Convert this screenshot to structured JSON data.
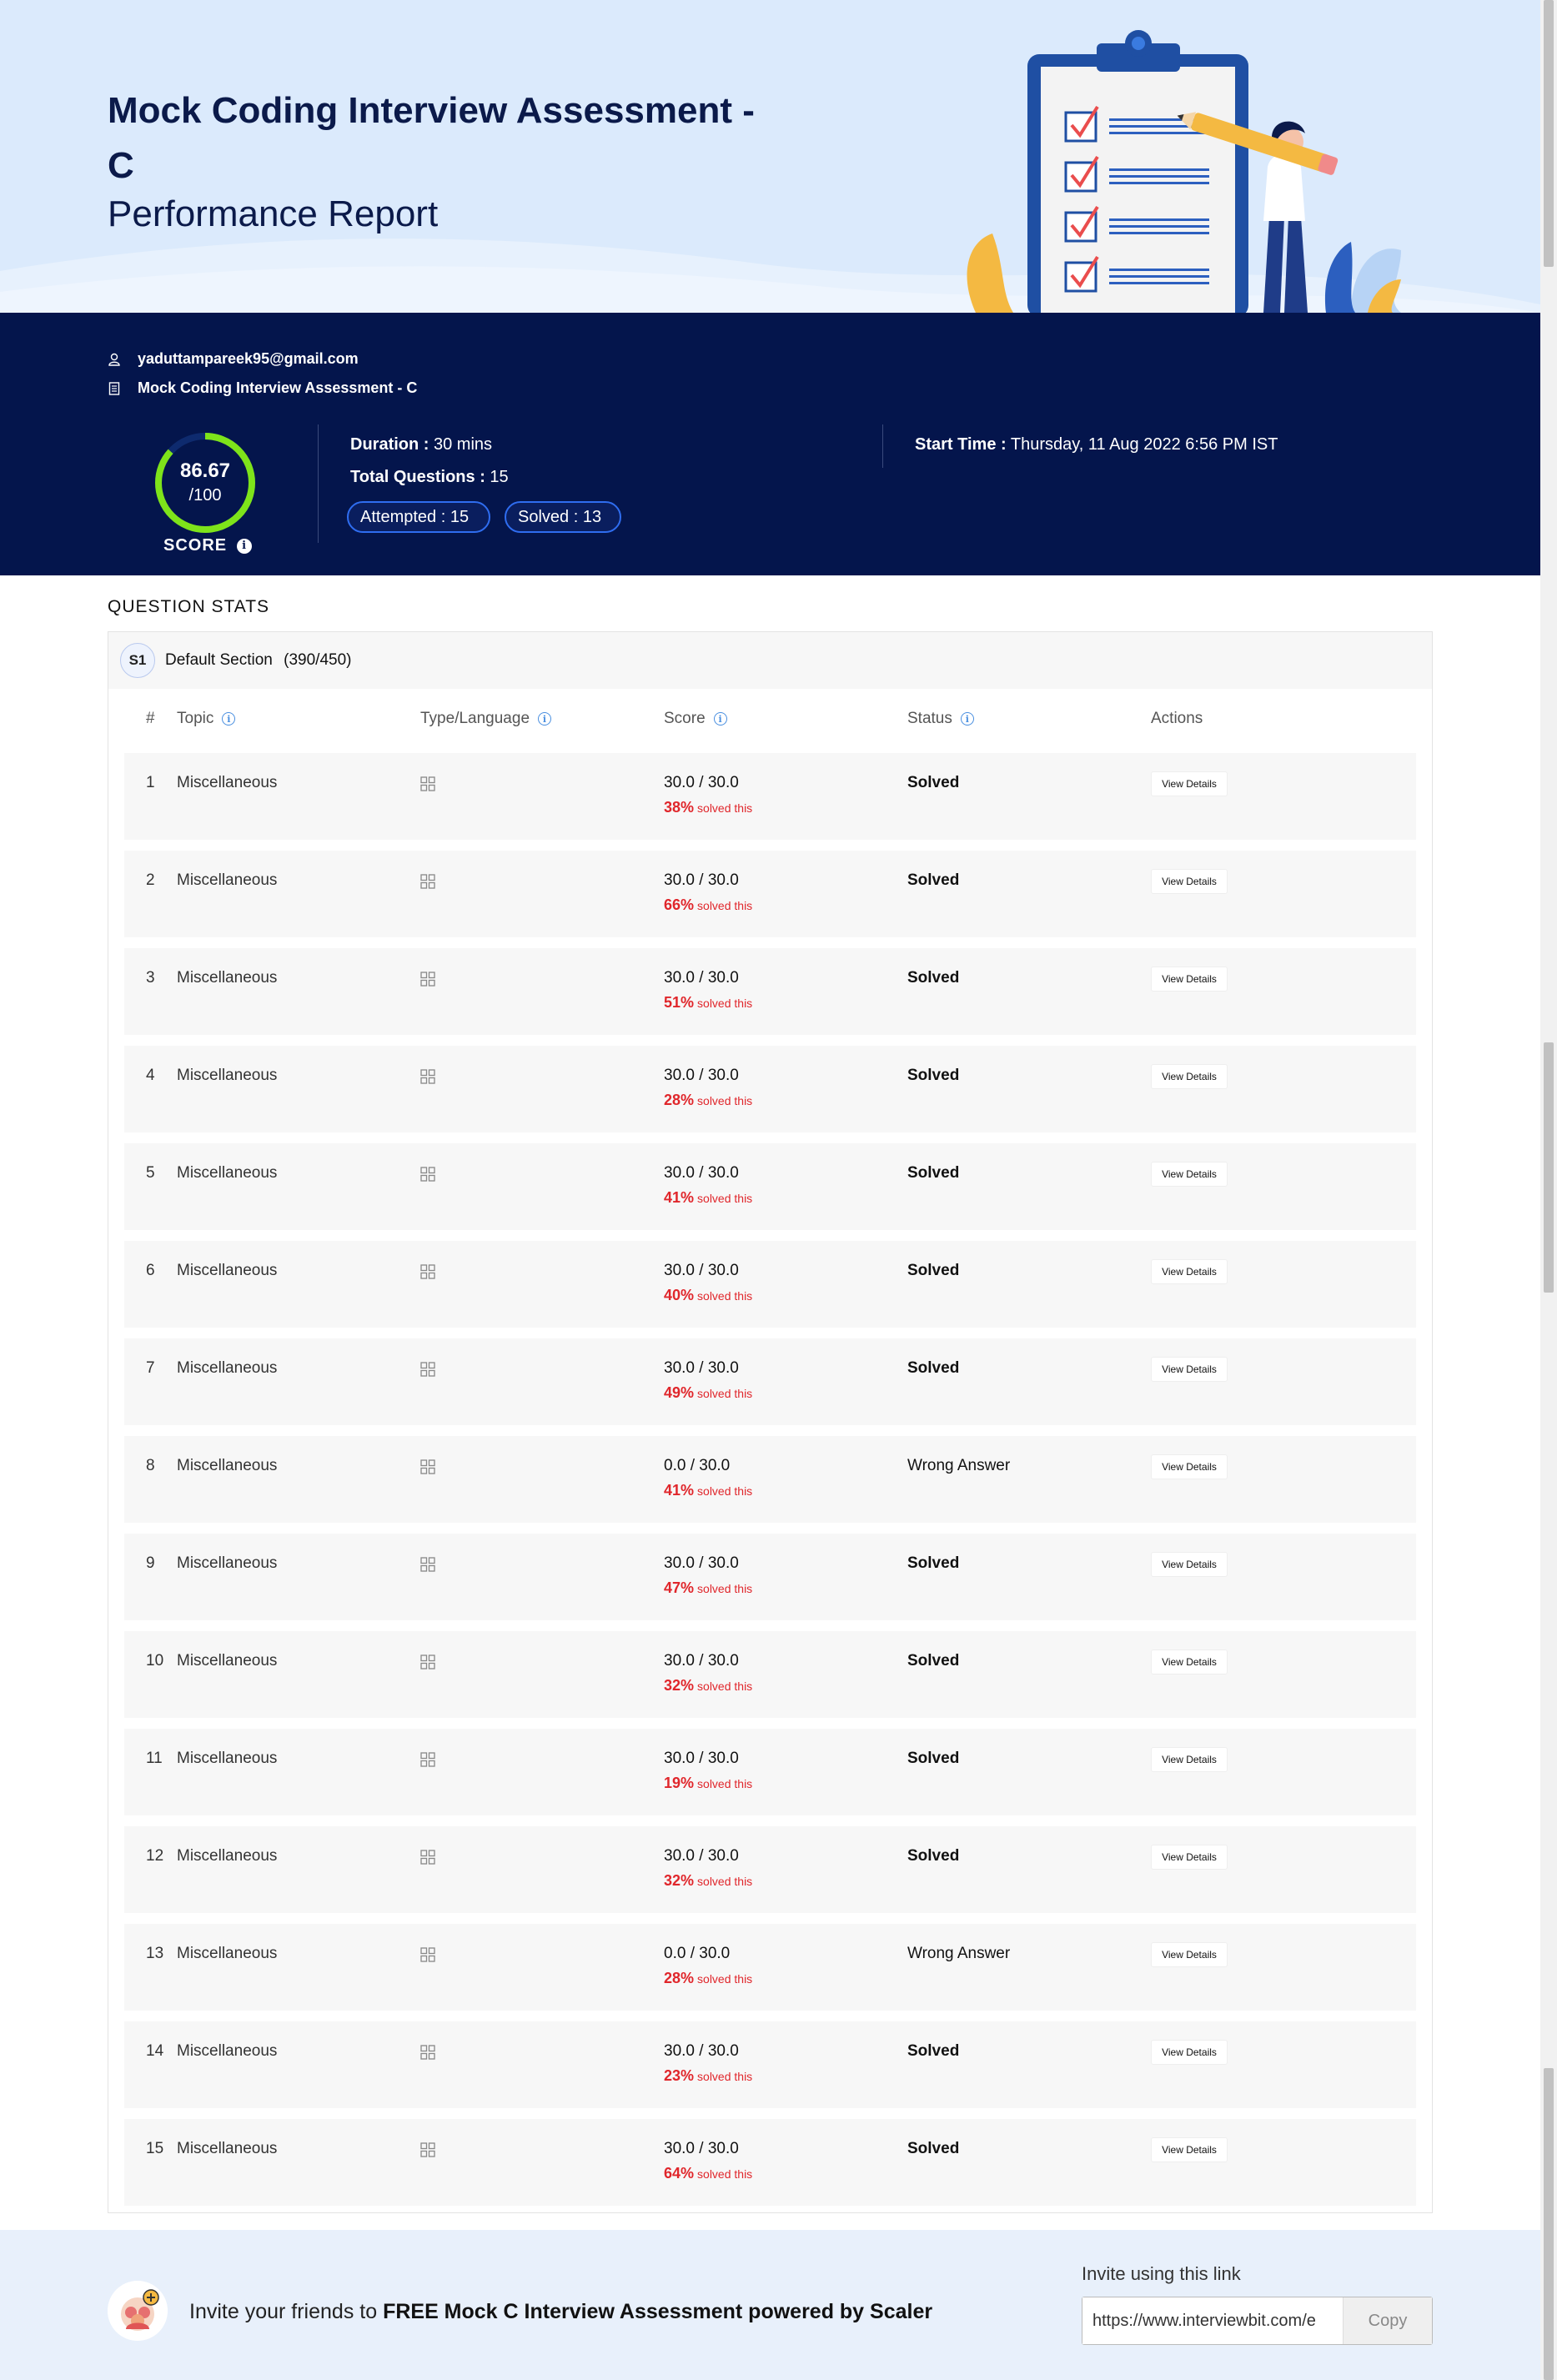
{
  "hero": {
    "title": "Mock Coding Interview Assessment - C",
    "subtitle": "Performance Report"
  },
  "summary": {
    "email": "yaduttampareek95@gmail.com",
    "assessment_name": "Mock Coding Interview Assessment - C",
    "score_value": "86.67",
    "score_total": "/100",
    "score_fraction": 0.8667,
    "score_label": "SCORE",
    "duration_label": "Duration :",
    "duration_value": "30 mins",
    "total_questions_label": "Total Questions :",
    "total_questions_value": "15",
    "attempted_pill": "Attempted : 15",
    "solved_pill": "Solved : 13",
    "start_time_label": "Start Time :",
    "start_time_value": "Thursday, 11 Aug 2022 6:56 PM IST"
  },
  "question_stats": {
    "heading": "QUESTION STATS",
    "section_badge": "S1",
    "section_name": "Default Section",
    "section_score": "(390/450)",
    "columns": {
      "num": "#",
      "topic": "Topic",
      "type": "Type/Language",
      "score": "Score",
      "status": "Status",
      "actions": "Actions"
    },
    "solved_suffix": "solved this",
    "action_label": "View Details",
    "rows": [
      {
        "num": "1",
        "topic": "Miscellaneous",
        "score": "30.0 / 30.0",
        "pct": "38%",
        "status": "Solved"
      },
      {
        "num": "2",
        "topic": "Miscellaneous",
        "score": "30.0 / 30.0",
        "pct": "66%",
        "status": "Solved"
      },
      {
        "num": "3",
        "topic": "Miscellaneous",
        "score": "30.0 / 30.0",
        "pct": "51%",
        "status": "Solved"
      },
      {
        "num": "4",
        "topic": "Miscellaneous",
        "score": "30.0 / 30.0",
        "pct": "28%",
        "status": "Solved"
      },
      {
        "num": "5",
        "topic": "Miscellaneous",
        "score": "30.0 / 30.0",
        "pct": "41%",
        "status": "Solved"
      },
      {
        "num": "6",
        "topic": "Miscellaneous",
        "score": "30.0 / 30.0",
        "pct": "40%",
        "status": "Solved"
      },
      {
        "num": "7",
        "topic": "Miscellaneous",
        "score": "30.0 / 30.0",
        "pct": "49%",
        "status": "Solved"
      },
      {
        "num": "8",
        "topic": "Miscellaneous",
        "score": "0.0 / 30.0",
        "pct": "41%",
        "status": "Wrong Answer"
      },
      {
        "num": "9",
        "topic": "Miscellaneous",
        "score": "30.0 / 30.0",
        "pct": "47%",
        "status": "Solved"
      },
      {
        "num": "10",
        "topic": "Miscellaneous",
        "score": "30.0 / 30.0",
        "pct": "32%",
        "status": "Solved"
      },
      {
        "num": "11",
        "topic": "Miscellaneous",
        "score": "30.0 / 30.0",
        "pct": "19%",
        "status": "Solved"
      },
      {
        "num": "12",
        "topic": "Miscellaneous",
        "score": "30.0 / 30.0",
        "pct": "32%",
        "status": "Solved"
      },
      {
        "num": "13",
        "topic": "Miscellaneous",
        "score": "0.0 / 30.0",
        "pct": "28%",
        "status": "Wrong Answer"
      },
      {
        "num": "14",
        "topic": "Miscellaneous",
        "score": "30.0 / 30.0",
        "pct": "23%",
        "status": "Solved"
      },
      {
        "num": "15",
        "topic": "Miscellaneous",
        "score": "30.0 / 30.0",
        "pct": "64%",
        "status": "Solved"
      }
    ]
  },
  "footer": {
    "invite_prefix": "Invite your friends to ",
    "invite_bold": "FREE Mock C Interview Assessment powered by Scaler",
    "invite_label": "Invite using this link",
    "invite_link": "https://www.interviewbit.com/e",
    "copy_label": "Copy"
  },
  "colors": {
    "hero_bg": "#dbeafc",
    "summary_bg": "#04154c",
    "score_ring": "#7ee31a",
    "pill_border": "#2f6df0",
    "percent_red": "#e0262b",
    "info_blue": "#4a8fe0"
  },
  "icons": {
    "email": "user-icon",
    "assessment": "document-icon",
    "score_info": "info-icon",
    "type": "grid-icon"
  }
}
